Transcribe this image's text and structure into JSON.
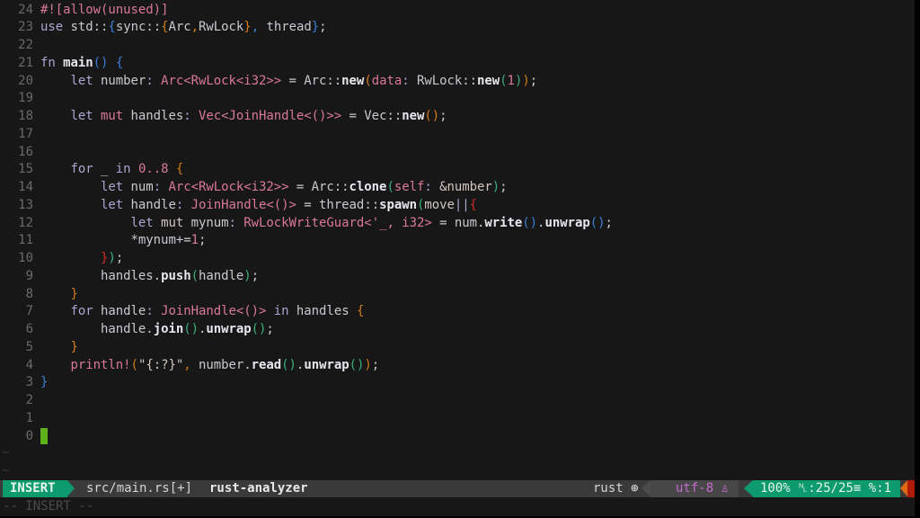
{
  "editor": {
    "lines": [
      {
        "num": "24",
        "code": [
          [
            "at",
            "#![allow(unused)]"
          ]
        ]
      },
      {
        "num": "23",
        "code": [
          [
            "kw",
            "use "
          ],
          [
            "pl",
            "std::"
          ],
          [
            "pb",
            "{"
          ],
          [
            "pl",
            "sync::"
          ],
          [
            "po",
            "{"
          ],
          [
            "pl",
            "Arc"
          ],
          [
            "po",
            ","
          ],
          [
            "pl",
            "RwLock"
          ],
          [
            "po",
            "}"
          ],
          [
            "pb",
            ","
          ],
          [
            "pl",
            " thread"
          ],
          [
            "pb",
            "}"
          ],
          [
            "pl",
            ";"
          ]
        ]
      },
      {
        "num": "22",
        "code": []
      },
      {
        "num": "21",
        "code": [
          [
            "kw",
            "fn "
          ],
          [
            "fn",
            "main"
          ],
          [
            "pb",
            "()"
          ],
          [
            "pl",
            " "
          ],
          [
            "pb",
            "{"
          ]
        ]
      },
      {
        "num": "20",
        "code": [
          [
            "pl",
            "    "
          ],
          [
            "kw",
            "let "
          ],
          [
            "pl",
            "number"
          ],
          [
            "pu",
            ": "
          ],
          [
            "ty",
            "Arc<RwLock<i32>>"
          ],
          [
            "pl",
            " = Arc::"
          ],
          [
            "fn",
            "new"
          ],
          [
            "po",
            "("
          ],
          [
            "ty",
            "data"
          ],
          [
            "pu",
            ": "
          ],
          [
            "pl",
            "RwLock::"
          ],
          [
            "fn",
            "new"
          ],
          [
            "pg",
            "("
          ],
          [
            "nm",
            "1"
          ],
          [
            "pg",
            ")"
          ],
          [
            "po",
            ")"
          ],
          [
            "pl",
            ";"
          ]
        ]
      },
      {
        "num": "19",
        "code": []
      },
      {
        "num": "18",
        "code": [
          [
            "pl",
            "    "
          ],
          [
            "kw",
            "let "
          ],
          [
            "ty",
            "mut "
          ],
          [
            "pl",
            "handles"
          ],
          [
            "pu",
            ": "
          ],
          [
            "ty",
            "Vec<JoinHandle<()>>"
          ],
          [
            "pl",
            " = Vec::"
          ],
          [
            "fn",
            "new"
          ],
          [
            "po",
            "()"
          ],
          [
            "pl",
            ";"
          ]
        ]
      },
      {
        "num": "17",
        "code": []
      },
      {
        "num": "16",
        "code": []
      },
      {
        "num": "15",
        "code": [
          [
            "pl",
            "    "
          ],
          [
            "kw",
            "for "
          ],
          [
            "pl",
            "_ "
          ],
          [
            "kw",
            "in "
          ],
          [
            "nm",
            "0..8"
          ],
          [
            "pl",
            " "
          ],
          [
            "po",
            "{"
          ]
        ]
      },
      {
        "num": "14",
        "code": [
          [
            "pl",
            "        "
          ],
          [
            "kw",
            "let "
          ],
          [
            "pl",
            "num"
          ],
          [
            "pu",
            ": "
          ],
          [
            "ty",
            "Arc<RwLock<i32>>"
          ],
          [
            "pl",
            " = Arc::"
          ],
          [
            "fn",
            "clone"
          ],
          [
            "pg",
            "("
          ],
          [
            "ty",
            "self"
          ],
          [
            "pu",
            ": "
          ],
          [
            "st",
            "&number"
          ],
          [
            "pg",
            ")"
          ],
          [
            "pl",
            ";"
          ]
        ]
      },
      {
        "num": "13",
        "code": [
          [
            "pl",
            "        "
          ],
          [
            "kw",
            "let "
          ],
          [
            "pl",
            "handle"
          ],
          [
            "pu",
            ": "
          ],
          [
            "ty",
            "JoinHandle<()>"
          ],
          [
            "pl",
            " = thread::"
          ],
          [
            "fn",
            "spawn"
          ],
          [
            "pg",
            "("
          ],
          [
            "st",
            "move"
          ],
          [
            "pu",
            "||"
          ],
          [
            "pr",
            "{"
          ]
        ]
      },
      {
        "num": "12",
        "code": [
          [
            "pl",
            "            "
          ],
          [
            "kw",
            "let "
          ],
          [
            "st",
            "mut "
          ],
          [
            "pl",
            "mynum"
          ],
          [
            "pu",
            ": "
          ],
          [
            "ty",
            "RwLockWriteGuard<'_, i32>"
          ],
          [
            "pl",
            " = num."
          ],
          [
            "fn",
            "write"
          ],
          [
            "pb",
            "()"
          ],
          [
            "pl",
            "."
          ],
          [
            "fn",
            "unwrap"
          ],
          [
            "pb",
            "()"
          ],
          [
            "pl",
            ";"
          ]
        ]
      },
      {
        "num": "11",
        "code": [
          [
            "pl",
            "            *mynum+="
          ],
          [
            "nm",
            "1"
          ],
          [
            "pl",
            ";"
          ]
        ]
      },
      {
        "num": "10",
        "code": [
          [
            "pl",
            "        "
          ],
          [
            "pr",
            "}"
          ],
          [
            "pg",
            ")"
          ],
          [
            "pl",
            ";"
          ]
        ]
      },
      {
        "num": "9",
        "code": [
          [
            "pl",
            "        handles."
          ],
          [
            "fn",
            "push"
          ],
          [
            "pg",
            "("
          ],
          [
            "pl",
            "handle"
          ],
          [
            "pg",
            ")"
          ],
          [
            "pl",
            ";"
          ]
        ]
      },
      {
        "num": "8",
        "code": [
          [
            "pl",
            "    "
          ],
          [
            "po",
            "}"
          ]
        ]
      },
      {
        "num": "7",
        "code": [
          [
            "pl",
            "    "
          ],
          [
            "kw",
            "for "
          ],
          [
            "pl",
            "handle"
          ],
          [
            "pu",
            ": "
          ],
          [
            "ty",
            "JoinHandle<()>"
          ],
          [
            "pl",
            " "
          ],
          [
            "kw",
            "in "
          ],
          [
            "pl",
            "handles "
          ],
          [
            "po",
            "{"
          ]
        ]
      },
      {
        "num": "6",
        "code": [
          [
            "pl",
            "        handle."
          ],
          [
            "fn",
            "join"
          ],
          [
            "pg",
            "()"
          ],
          [
            "pl",
            "."
          ],
          [
            "fn",
            "unwrap"
          ],
          [
            "pg",
            "()"
          ],
          [
            "pl",
            ";"
          ]
        ]
      },
      {
        "num": "5",
        "code": [
          [
            "pl",
            "    "
          ],
          [
            "po",
            "}"
          ]
        ]
      },
      {
        "num": "4",
        "code": [
          [
            "pl",
            "    "
          ],
          [
            "ty",
            "println!"
          ],
          [
            "po",
            "("
          ],
          [
            "st",
            "\"{:?}\""
          ],
          [
            "po",
            ","
          ],
          [
            "pl",
            " number."
          ],
          [
            "fn",
            "read"
          ],
          [
            "pg",
            "()"
          ],
          [
            "pl",
            "."
          ],
          [
            "fn",
            "unwrap"
          ],
          [
            "pg",
            "()"
          ],
          [
            "po",
            ")"
          ],
          [
            "pl",
            ";"
          ]
        ]
      },
      {
        "num": "3",
        "code": [
          [
            "pb",
            "}"
          ]
        ]
      },
      {
        "num": "2",
        "code": []
      },
      {
        "num": "1",
        "code": []
      },
      {
        "num": "0",
        "code": [],
        "cursor": true
      }
    ],
    "tildes": [
      "~",
      "~"
    ]
  },
  "statusline": {
    "mode": "INSERT",
    "file": "src/main.rs[+]",
    "lsp": "rust-analyzer",
    "filetype": "rust ⊛",
    "encoding": "utf-8 ♙",
    "position": "100% ␤:25/25≡ %:1"
  },
  "cmdline": "-- INSERT --",
  "colors": {
    "mode_bg": "#0d9a6d",
    "cursor": "#5fb31a",
    "warning": "#e06a10",
    "error": "#b01a0a"
  }
}
